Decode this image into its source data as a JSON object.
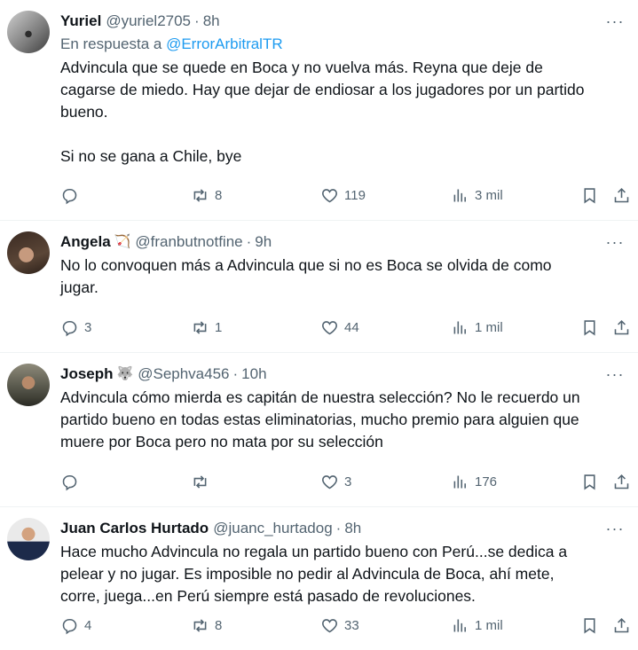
{
  "tweets": [
    {
      "name": "Yuriel",
      "emoji": "",
      "handle": "@yuriel2705",
      "time": "8h",
      "reply_prefix": "En respuesta a ",
      "reply_handle": "@ErrorArbitralTR",
      "text": "Advincula que se quede en Boca y no vuelva más. Reyna que deje de\ncagarse de miedo. Hay que dejar de endiosar a los jugadores por un partido\nbueno.\n\nSi no se gana a Chile, bye",
      "replies": "",
      "retweets": "8",
      "likes": "119",
      "views": "3 mil"
    },
    {
      "name": "Angela",
      "emoji": "🏹",
      "handle": "@franbutnotfine",
      "time": "9h",
      "text": "No lo convoquen más a Advincula que si no es Boca se olvida de como\njugar.",
      "replies": "3",
      "retweets": "1",
      "likes": "44",
      "views": "1 mil"
    },
    {
      "name": "Joseph",
      "emoji": "🐺",
      "handle": "@Sephva456",
      "time": "10h",
      "text": "Advincula cómo mierda es capitán de nuestra selección? No le recuerdo un\npartido bueno en todas estas eliminatorias, mucho premio para alguien que\nmuere por Boca pero no mata por su selección",
      "replies": "",
      "retweets": "",
      "likes": "3",
      "views": "176"
    },
    {
      "name": "Juan Carlos Hurtado",
      "emoji": "",
      "handle": "@juanc_hurtadog",
      "time": "8h",
      "text": "Hace mucho Advincula no regala un partido bueno con Perú...se dedica a\npelear y no jugar. Es imposible no pedir al Advincula de Boca, ahí mete,\ncorre, juega...en Perú siempre está pasado de revoluciones.",
      "replies": "4",
      "retweets": "8",
      "likes": "33",
      "views": "1 mil"
    }
  ],
  "separator": "·",
  "more_icon": "···"
}
